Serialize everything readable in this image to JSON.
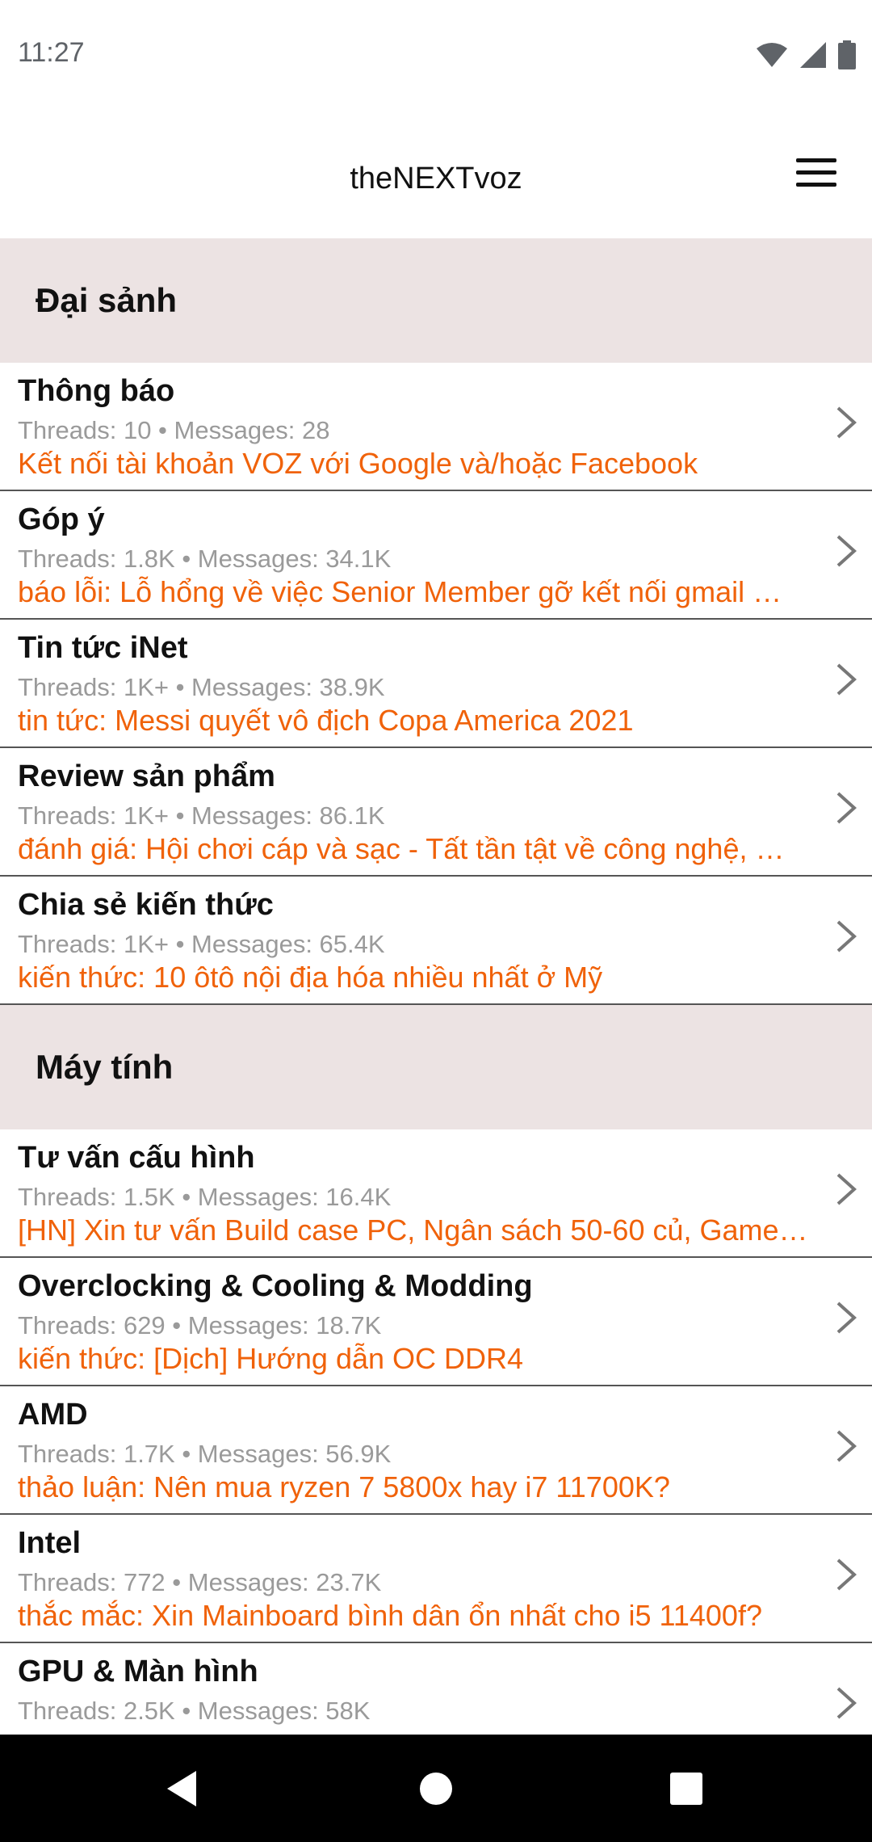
{
  "status_bar": {
    "time": "11:27",
    "icons": [
      "wifi-icon",
      "signal-icon",
      "battery-icon"
    ]
  },
  "app_bar": {
    "title": "theNEXTvoz",
    "menu_icon": "hamburger-menu-icon"
  },
  "sections": [
    {
      "title": "Đại sảnh",
      "forums": [
        {
          "name": "Thông báo",
          "stats": "Threads: 10 • Messages: 28",
          "latest": "Kết nối tài khoản VOZ với Google và/hoặc Facebook"
        },
        {
          "name": "Góp ý",
          "stats": "Threads: 1.8K • Messages: 34.1K",
          "latest": "báo lỗi: Lỗ hổng về việc Senior Member gỡ kết nối gmail …"
        },
        {
          "name": "Tin tức iNet",
          "stats": "Threads: 1K+ • Messages: 38.9K",
          "latest": "tin tức: Messi quyết vô địch Copa America 2021"
        },
        {
          "name": "Review sản phẩm",
          "stats": "Threads: 1K+ • Messages: 86.1K",
          "latest": "đánh giá: Hội chơi cáp và sạc - Tất tần tật về công nghệ, …"
        },
        {
          "name": "Chia sẻ kiến thức",
          "stats": "Threads: 1K+ • Messages: 65.4K",
          "latest": "kiến thức: 10 ôtô nội địa hóa nhiều nhất ở Mỹ"
        }
      ]
    },
    {
      "title": "Máy tính",
      "forums": [
        {
          "name": "Tư vấn cấu hình",
          "stats": "Threads: 1.5K • Messages: 16.4K",
          "latest": "[HN] Xin tư vấn Build case PC, Ngân sách 50-60 củ, Game…"
        },
        {
          "name": "Overclocking & Cooling & Modding",
          "stats": "Threads: 629 • Messages: 18.7K",
          "latest": "kiến thức: [Dịch] Hướng dẫn OC DDR4"
        },
        {
          "name": "AMD",
          "stats": "Threads: 1.7K • Messages: 56.9K",
          "latest": "thảo luận: Nên mua ryzen 7 5800x hay i7 11700K?"
        },
        {
          "name": "Intel",
          "stats": "Threads: 772 • Messages: 23.7K",
          "latest": "thắc mắc: Xin Mainboard bình dân ổn nhất cho i5 11400f?"
        },
        {
          "name": "GPU & Màn hình",
          "stats": "Threads: 2.5K • Messages: 58K",
          "latest": ""
        }
      ]
    }
  ],
  "nav_bar": {
    "buttons": [
      "back-icon",
      "home-icon",
      "recents-icon"
    ]
  },
  "colors": {
    "accent": "#f0620a",
    "section_bg": "#ece3e3",
    "stats_text": "#9a9a9a",
    "divider": "#555555"
  }
}
